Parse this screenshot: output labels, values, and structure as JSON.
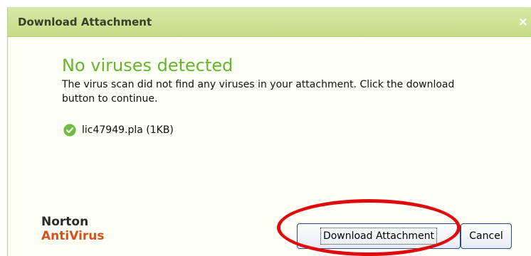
{
  "dialog": {
    "title": "Download Attachment",
    "close_symbol": "×",
    "heading": "No viruses detected",
    "message": "The virus scan did not find any viruses in your attachment. Click the download button to continue.",
    "file": {
      "name": "lic47949.pla (1KB)",
      "status_icon": "check-circle-icon"
    },
    "brand": {
      "line1": "Norton",
      "line2": "AntiVirus"
    },
    "buttons": {
      "download": "Download Attachment",
      "cancel": "Cancel"
    }
  },
  "colors": {
    "title_bar": "#cde094",
    "heading": "#66b52b",
    "brand_accent": "#d5511a",
    "annotation": "#e10a0a"
  }
}
